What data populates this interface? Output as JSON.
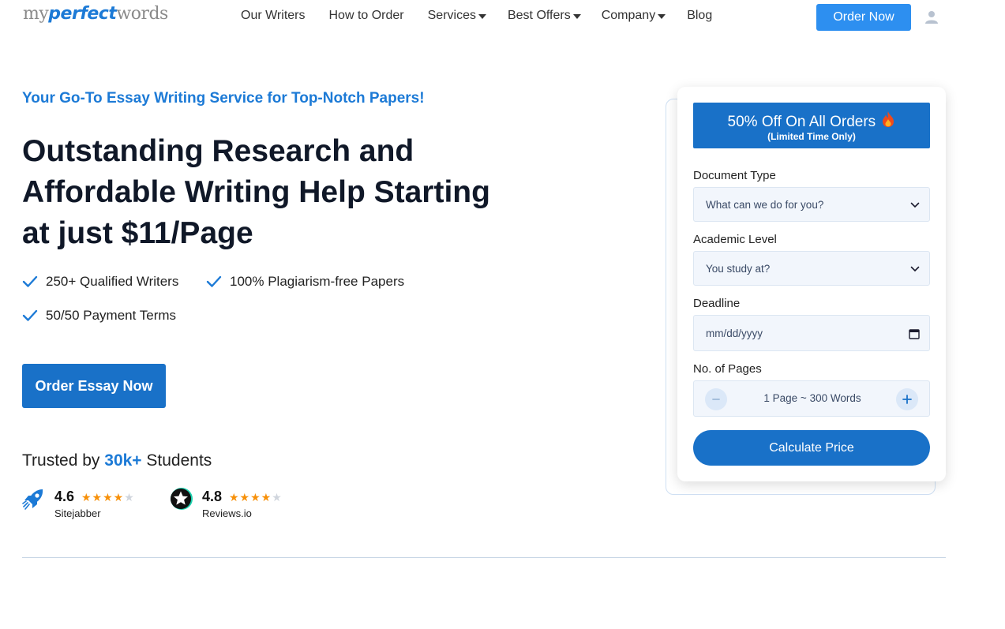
{
  "header": {
    "logo": {
      "part1": "my",
      "part2": "perfect",
      "part3": "words"
    },
    "nav": [
      {
        "label": "Our Writers",
        "dropdown": false
      },
      {
        "label": "How to Order",
        "dropdown": false
      },
      {
        "label": "Services",
        "dropdown": true
      },
      {
        "label": "Best Offers",
        "dropdown": true
      },
      {
        "label": "Company",
        "dropdown": true
      },
      {
        "label": "Blog",
        "dropdown": false
      }
    ],
    "order_button": "Order Now",
    "user_icon": "user-icon"
  },
  "hero": {
    "tagline": "Your Go-To Essay Writing Service for Top-Notch Papers!",
    "title_lines": [
      "Outstanding Research and",
      "Affordable Writing Help Starting",
      "at just $11/Page"
    ],
    "features": [
      "250+ Qualified Writers",
      "100% Plagiarism-free Papers",
      "50/50 Payment Terms"
    ],
    "cta": "Order Essay Now",
    "trusted": {
      "prefix": "Trusted by ",
      "highlight": "30k+",
      "suffix": " Students"
    },
    "ratings": [
      {
        "score": "4.6",
        "source": "Sitejabber",
        "stars": 4,
        "icon": "rocket-icon"
      },
      {
        "score": "4.8",
        "source": "Reviews.io",
        "stars": 4,
        "icon": "star-badge-icon"
      }
    ]
  },
  "form": {
    "promo": {
      "main": "50% Off On All Orders",
      "sub": "(Limited Time Only)",
      "icon": "flame-icon"
    },
    "document_type": {
      "label": "Document Type",
      "placeholder": "What can we do for you?"
    },
    "academic_level": {
      "label": "Academic Level",
      "placeholder": "You study at?"
    },
    "deadline": {
      "label": "Deadline",
      "placeholder": "mm/dd/yyyy"
    },
    "pages": {
      "label": "No. of Pages",
      "value": "1 Page ~ 300 Words"
    },
    "submit": "Calculate Price"
  },
  "colors": {
    "brand_blue": "#1971c8",
    "accent_blue": "#2d8ff0",
    "star": "#f79009"
  }
}
